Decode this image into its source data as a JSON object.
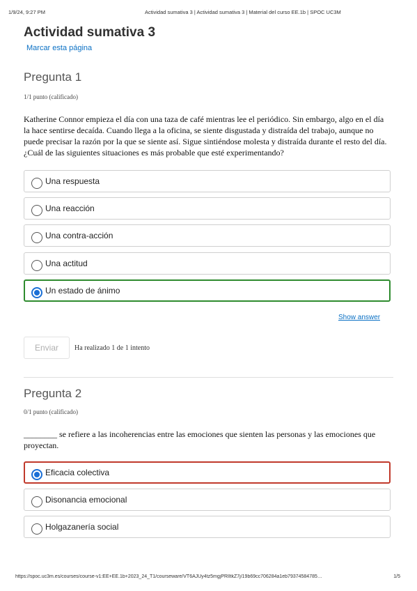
{
  "print": {
    "date": "1/9/24, 9:27 PM",
    "title": "Actividad sumativa 3 | Actividad sumativa 3 | Material del curso EE.1b | SPOC UC3M",
    "url": "https://spoc.uc3m.es/courses/course-v1:EE+EE.1b+2023_24_T1/courseware/VT6AJUy4tz5mgjPRIltkZ7j/19b69cc706284a1eb79374584785…",
    "page": "1/5"
  },
  "page_title": "Actividad sumativa 3",
  "bookmark_label": "Marcar esta página",
  "questions": [
    {
      "heading": "Pregunta 1",
      "points": "1/1 punto (calificado)",
      "text_lines": [
        "Katherine Connor empieza el día con una taza de café mientras lee el periódico. Sin embargo, algo en el día",
        "la hace sentirse decaída. Cuando llega a la oficina, se siente disgustada y distraída del trabajo, aunque no",
        "puede precisar la razón por la que se siente así. Sigue sintiéndose molesta y distraída durante el resto del día.",
        "¿Cuál de las siguientes situaciones es más probable que esté experimentando?"
      ],
      "options": [
        {
          "label": "Una respuesta"
        },
        {
          "label": "Una reacción"
        },
        {
          "label": "Una contra-acción"
        },
        {
          "label": "Una actitud"
        },
        {
          "label": "Un estado de ánimo"
        }
      ],
      "selected_index": 4,
      "show_answer_label": "Show answer",
      "submit_label": "Enviar",
      "attempts_text": "Ha realizado 1 de 1 intento"
    },
    {
      "heading": "Pregunta 2",
      "points": "0/1 punto (calificado)",
      "text_lines": [
        "________ se refiere a las incoherencias entre las emociones que sienten las personas y las emociones que",
        "proyectan."
      ],
      "options": [
        {
          "label": "Eficacia colectiva"
        },
        {
          "label": "Disonancia emocional"
        },
        {
          "label": "Holgazanería social"
        }
      ],
      "selected_index": 0
    }
  ],
  "colors": {
    "link": "#0a70c4",
    "correct_border": "#2e8b2e",
    "wrong_border": "#c0392b",
    "radio_selected": "#1a6fd6"
  }
}
